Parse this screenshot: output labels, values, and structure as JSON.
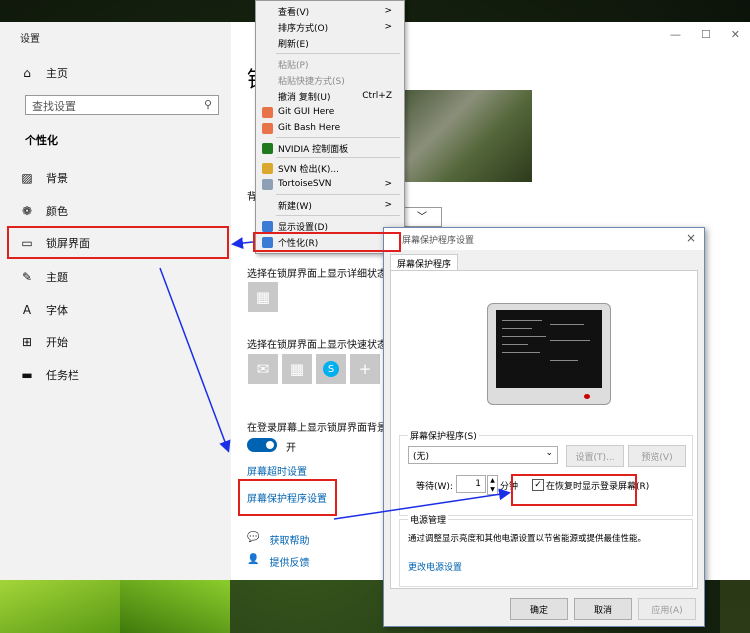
{
  "settings": {
    "window_title": "设置",
    "home": "主页",
    "search_placeholder": "查找设置",
    "section": "个性化",
    "nav": [
      {
        "icon": "▨",
        "label": "背景"
      },
      {
        "icon": "❁",
        "label": "颜色"
      },
      {
        "icon": "▭",
        "label": "锁屏界面"
      },
      {
        "icon": "✎",
        "label": "主题"
      },
      {
        "icon": "A",
        "label": "字体"
      },
      {
        "icon": "⊞",
        "label": "开始"
      },
      {
        "icon": "▬",
        "label": "任务栏"
      }
    ],
    "page_heading_char": "锁",
    "bg_label_char": "背",
    "detail_status_label": "选择在锁屏界面上显示详细状态",
    "quick_status_label": "选择在锁屏界面上显示快速状态",
    "signin_bg_label": "在登录屏幕上显示锁屏界面背景",
    "toggle_state": "开",
    "screen_timeout_link": "屏幕超时设置",
    "screensaver_link": "屏幕保护程序设置",
    "help_link": "获取帮助",
    "feedback_link": "提供反馈"
  },
  "context_menu": {
    "items": [
      {
        "label": "查看(V)",
        "arrow": ">"
      },
      {
        "label": "排序方式(O)",
        "arrow": ">"
      },
      {
        "label": "刷新(E)"
      },
      {
        "label": "粘贴(P)",
        "disabled": true
      },
      {
        "label": "粘贴快捷方式(S)",
        "disabled": true
      },
      {
        "label": "撤消 复制(U)",
        "shortcut": "Ctrl+Z"
      },
      {
        "label": "Git GUI Here"
      },
      {
        "label": "Git Bash Here"
      },
      {
        "label": "NVIDIA 控制面板"
      },
      {
        "label": "SVN 检出(K)..."
      },
      {
        "label": "TortoiseSVN",
        "arrow": ">"
      },
      {
        "label": "新建(W)",
        "arrow": ">"
      },
      {
        "label": "显示设置(D)"
      },
      {
        "label": "个性化(R)"
      }
    ]
  },
  "dialog": {
    "title": "屏幕保护程序设置",
    "close": "×",
    "tab": "屏幕保护程序",
    "group_label": "屏幕保护程序(S)",
    "selected_saver": "(无)",
    "settings_btn": "设置(T)...",
    "preview_btn": "预览(V)",
    "wait_label": "等待(W):",
    "wait_value": "1",
    "minutes": "分钟",
    "resume_checkbox": "在恢复时显示登录屏幕(R)",
    "resume_checked": true,
    "power_group": "电源管理",
    "power_desc": "通过调整显示亮度和其他电源设置以节省能源或提供最佳性能。",
    "power_link": "更改电源设置",
    "ok": "确定",
    "cancel": "取消",
    "apply": "应用(A)"
  },
  "window_controls": {
    "min": "—",
    "max": "☐",
    "close": "✕"
  },
  "colors": {
    "accent": "#0063b1",
    "annotation_red": "#e0201c",
    "annotation_blue": "#1a2ee8"
  }
}
